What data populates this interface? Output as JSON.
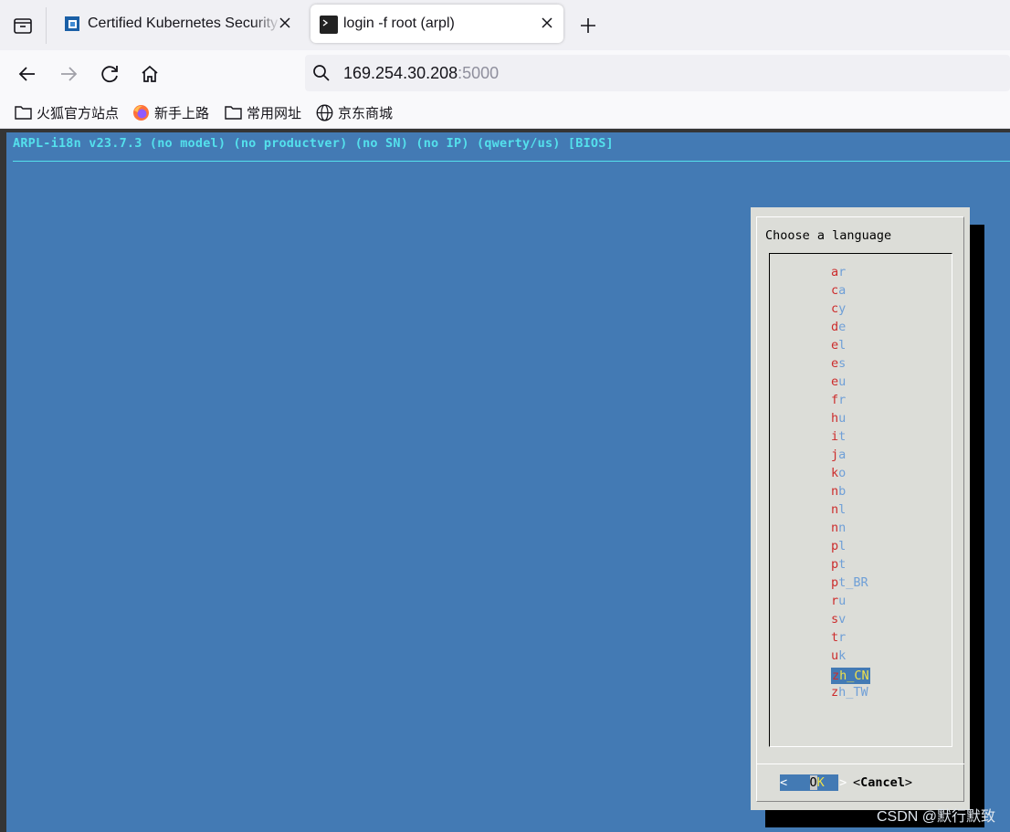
{
  "browser": {
    "tabs": [
      {
        "title": "Certified Kubernetes Security",
        "active": false
      },
      {
        "title": "login -f root (arpl)",
        "active": true
      }
    ],
    "url": {
      "host": "169.254.30.208",
      "port": ":5000"
    },
    "bookmarks": [
      {
        "label": "火狐官方站点",
        "icon": "folder-icon"
      },
      {
        "label": "新手上路",
        "icon": "firefox-icon"
      },
      {
        "label": "常用网址",
        "icon": "folder-icon"
      },
      {
        "label": "京东商城",
        "icon": "globe-icon"
      }
    ]
  },
  "terminal": {
    "header": "ARPL-i18n v23.7.3 (no model) (no productver) (no SN) (no IP) (qwerty/us) [BIOS]",
    "colors": {
      "background": "#437ab4",
      "header": "#54e0ec",
      "dialog": "#dcddd8"
    }
  },
  "dialog": {
    "title": "Choose a language",
    "items": [
      {
        "hk": "a",
        "rest": "r"
      },
      {
        "hk": "c",
        "rest": "a"
      },
      {
        "hk": "c",
        "rest": "y"
      },
      {
        "hk": "d",
        "rest": "e"
      },
      {
        "hk": "e",
        "rest": "l"
      },
      {
        "hk": "e",
        "rest": "s"
      },
      {
        "hk": "e",
        "rest": "u"
      },
      {
        "hk": "f",
        "rest": "r"
      },
      {
        "hk": "h",
        "rest": "u"
      },
      {
        "hk": "i",
        "rest": "t"
      },
      {
        "hk": "j",
        "rest": "a"
      },
      {
        "hk": "k",
        "rest": "o"
      },
      {
        "hk": "n",
        "rest": "b"
      },
      {
        "hk": "n",
        "rest": "l"
      },
      {
        "hk": "n",
        "rest": "n"
      },
      {
        "hk": "p",
        "rest": "l"
      },
      {
        "hk": "p",
        "rest": "t"
      },
      {
        "hk": "p",
        "rest": "t_BR"
      },
      {
        "hk": "r",
        "rest": "u"
      },
      {
        "hk": "s",
        "rest": "v"
      },
      {
        "hk": "t",
        "rest": "r"
      },
      {
        "hk": "u",
        "rest": "k"
      },
      {
        "hk": "z",
        "rest": "h_CN",
        "selected": true
      },
      {
        "hk": "z",
        "rest": "h_TW"
      }
    ],
    "ok_button": {
      "left": "<",
      "o": "O",
      "k": "K",
      "right": ">"
    },
    "cancel_button": {
      "left": "<",
      "hk": "C",
      "rest": "ancel",
      "right": ">"
    }
  },
  "watermark": "CSDN @默行默致"
}
